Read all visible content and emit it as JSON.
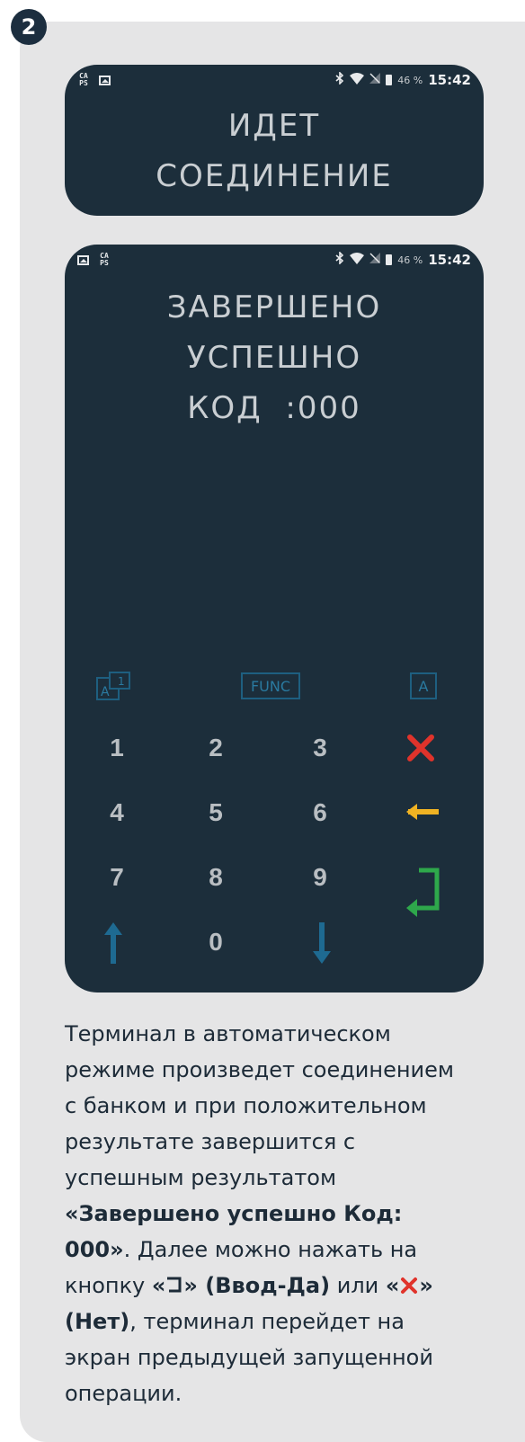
{
  "step": {
    "number": "2"
  },
  "screen_top": {
    "status": {
      "caps_icon": "CA\nPS",
      "battery": "46 %",
      "time": "15:42"
    },
    "message_line1": "ИДЕТ",
    "message_line2": "СОЕДИНЕНИЕ"
  },
  "screen_main": {
    "status": {
      "caps_icon": "CA\nPS",
      "battery": "46 %",
      "time": "15:42"
    },
    "line1": "ЗАВЕРШЕНО",
    "line2": "УСПЕШНО",
    "line3": "КОД  :000",
    "func_keys": {
      "alpha1": "A 1",
      "func": "FUNC",
      "alpha": "A"
    },
    "keys": [
      "1",
      "2",
      "3",
      "4",
      "5",
      "6",
      "7",
      "8",
      "9",
      "0"
    ],
    "icons": {
      "cancel": "cancel-x",
      "backspace": "arrow-left",
      "enter": "enter-return",
      "up": "arrow-up",
      "down": "arrow-down"
    },
    "colors": {
      "cancel": "#e0332b",
      "backspace": "#f0b323",
      "enter": "#2ea84b",
      "arrows": "#1e6a91"
    }
  },
  "description": {
    "p1": "Терминал в автоматическом режиме произведет соединением с банком и при положительном результате завершится с успешным результатом ",
    "bold1": "«Завершено успешно Код: 000»",
    "p2": ". Далее можно нажать на кнопку ",
    "bold2a": "«",
    "bold2b": "» (Ввод-Да)",
    "p3": " или ",
    "bold3a": "«",
    "bold3b": "» (Нет)",
    "p4": ", терминал перейдет на экран предыдущей запущенной операции."
  }
}
